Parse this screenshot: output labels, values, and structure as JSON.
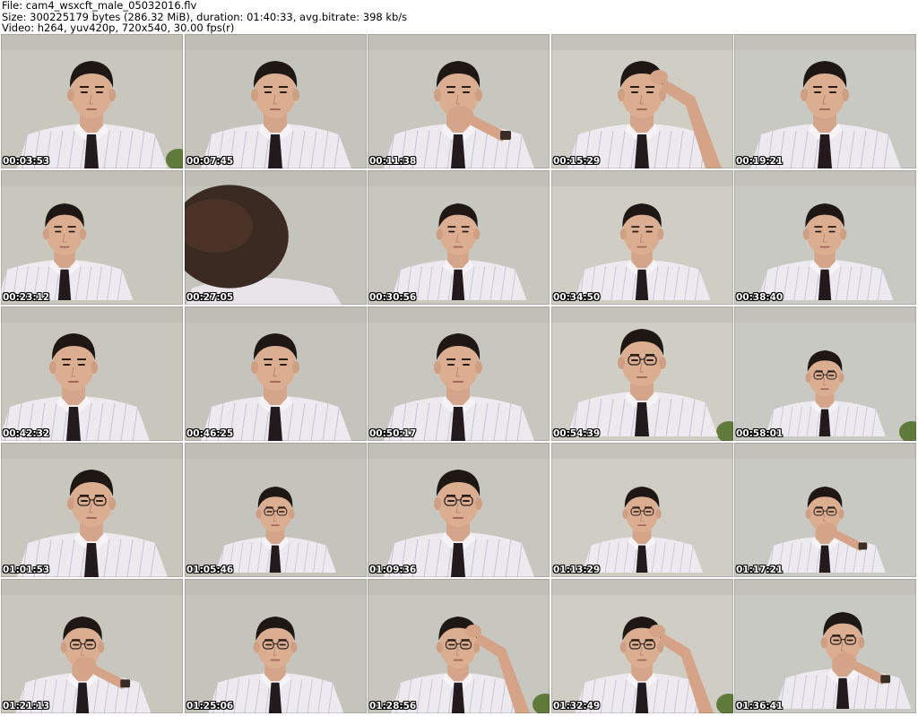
{
  "header": {
    "file_line": "File: cam4_wsxcft_male_05032016.flv",
    "size_line": "Size: 300225179 bytes (286.32 MiB), duration: 01:40:33, avg.bitrate: 398 kb/s",
    "video_line": "Video: h264, yuv420p, 720x540, 30.00 fps(r)"
  },
  "thumbnails": [
    {
      "timestamp": "00:03:53"
    },
    {
      "timestamp": "00:07:45"
    },
    {
      "timestamp": "00:11:38"
    },
    {
      "timestamp": "00:15:29"
    },
    {
      "timestamp": "00:19:21"
    },
    {
      "timestamp": "00:23:12"
    },
    {
      "timestamp": "00:27:05"
    },
    {
      "timestamp": "00:30:56"
    },
    {
      "timestamp": "00:34:50"
    },
    {
      "timestamp": "00:38:40"
    },
    {
      "timestamp": "00:42:32"
    },
    {
      "timestamp": "00:46:25"
    },
    {
      "timestamp": "00:50:17"
    },
    {
      "timestamp": "00:54:39"
    },
    {
      "timestamp": "00:58:01"
    },
    {
      "timestamp": "01:01:53"
    },
    {
      "timestamp": "01:05:46"
    },
    {
      "timestamp": "01:09:36"
    },
    {
      "timestamp": "01:13:29"
    },
    {
      "timestamp": "01:17:21"
    },
    {
      "timestamp": "01:21:13"
    },
    {
      "timestamp": "01:25:06"
    },
    {
      "timestamp": "01:28:56"
    },
    {
      "timestamp": "01:32:49"
    },
    {
      "timestamp": "01:36:41"
    }
  ]
}
